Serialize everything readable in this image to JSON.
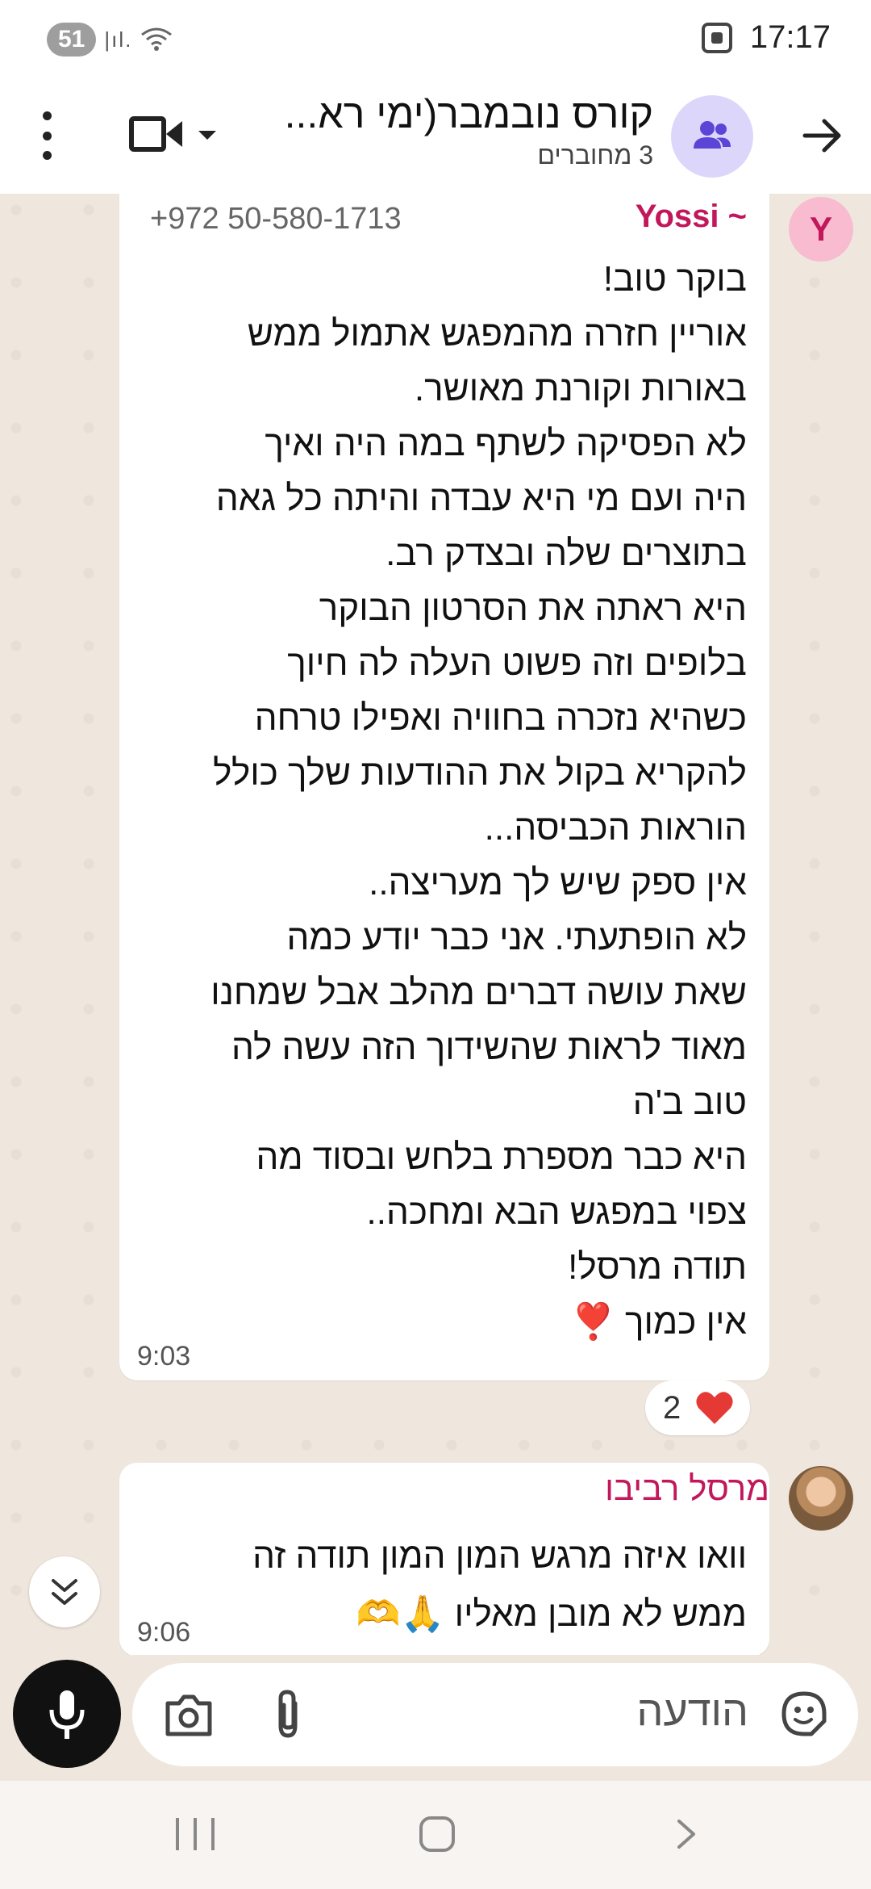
{
  "status_bar": {
    "battery": "51",
    "signal": "|ıl.",
    "time": "17:17"
  },
  "header": {
    "title": "קורס נובמבר(ימי רא...",
    "subtitle": "3 מחוברים"
  },
  "messages": [
    {
      "avatar_letter": "Y",
      "sender": "~ Yossi",
      "phone": "+972 50-580-1713",
      "lines": [
        "בוקר טוב!",
        "אוריין חזרה מהמפגש אתמול  ממש",
        "באורות וקורנת מאושר.",
        "לא הפסיקה לשתף במה היה ואיך",
        "היה ועם מי היא עבדה והיתה כל גאה",
        "בתוצרים שלה ובצדק רב.",
        "היא ראתה את הסרטון הבוקר",
        "בלופים וזה פשוט העלה לה חיוך",
        "כשהיא נזכרה בחוויה ואפילו טרחה",
        "להקריא בקול את ההודעות שלך כולל",
        "הוראות הכביסה...",
        "אין ספק שיש לך מעריצה..",
        "לא הופתעתי. אני כבר יודע כמה",
        "שאת עושה דברים מהלב אבל שמחנו",
        "מאוד לראות שהשידוך הזה עשה לה",
        "טוב ב'ה",
        "היא כבר מספרת בלחש ובסוד מה",
        "צפוי במפגש הבא ומחכה..",
        "תודה מרסל!",
        "אין כמוך ❣️"
      ],
      "time": "9:03",
      "reaction_count": "2"
    },
    {
      "sender": "מרסל רביבו",
      "lines": [
        "וואו איזה מרגש המון המון תודה זה",
        "ממש לא מובן מאליו 🙏🫶"
      ],
      "time": "9:06"
    }
  ],
  "composer": {
    "placeholder": "הודעה"
  },
  "colors": {
    "sender": "#c2185b",
    "chat_bg": "#efe7dd",
    "avatar_bg": "#ddd6fb",
    "heart": "#e53935"
  }
}
